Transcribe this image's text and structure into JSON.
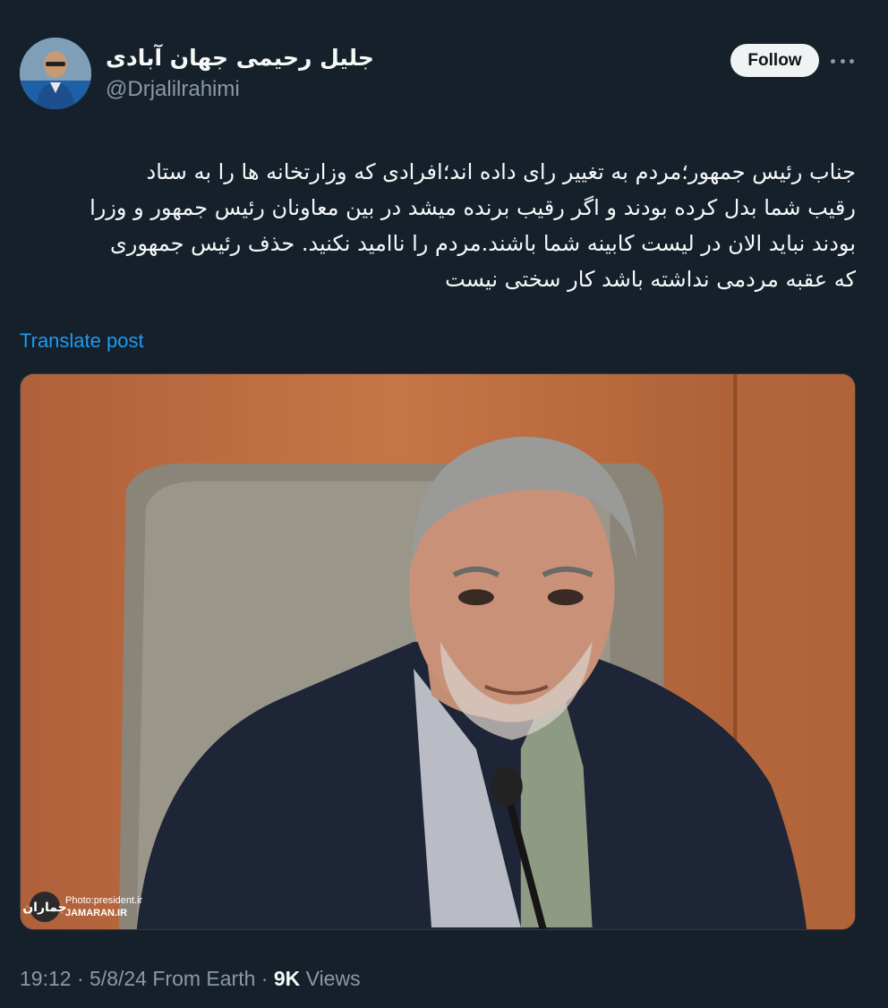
{
  "author": {
    "display_name": "جلیل رحیمی جهان آبادی",
    "handle": "@Drjalilrahimi"
  },
  "follow_label": "Follow",
  "more_icon": "more-horizontal-icon",
  "post": {
    "text": "جناب رئیس جمهور؛مردم به تغییر رای داده اند؛افرادی که وزارتخانه ها را به ستاد\nرقیب شما بدل کرده بودند و اگر رقیب برنده میشد در بین معاونان رئیس جمهور و وزرا\nبودند نباید الان در لیست کابینه شما باشند.مردم را ناامید نکنید. حذف رئیس جمهوری\nکه عقبه مردمی نداشته باشد کار سختی نیست",
    "translate_label": "Translate post"
  },
  "photo": {
    "credit_line1": "Photo:president.ir",
    "credit_line2": "JAMARAN.IR",
    "credit_logo": "جماران"
  },
  "meta": {
    "time": "19:12",
    "sep1": "·",
    "date": "5/8/24",
    "source": "From Earth",
    "sep2": "·",
    "views_count": "9K",
    "views_label": "Views"
  },
  "colors": {
    "background": "#15202b",
    "link": "#1d9bf0",
    "muted": "#8b98a5"
  }
}
